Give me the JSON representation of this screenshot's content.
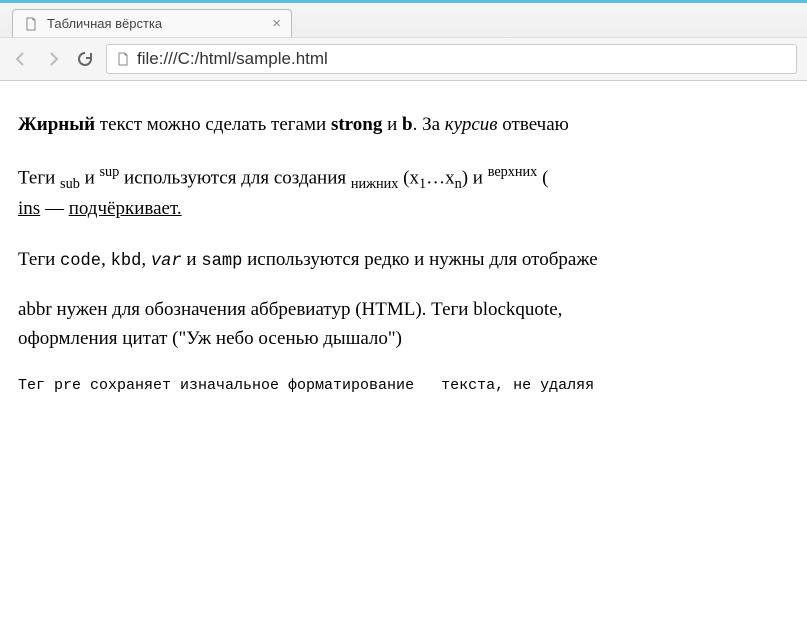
{
  "tab": {
    "title": "Табличная вёрстка"
  },
  "url": "file:///C:/html/sample.html",
  "para1": {
    "t1": "Жирный",
    "t2": " текст можно сделать тегами ",
    "t3": "strong",
    "t4": " и ",
    "t5": "b",
    "t6": ". За ",
    "t7": "курсив",
    "t8": " отвечаю"
  },
  "para2": {
    "t1": "Теги ",
    "t2": "sub",
    "t3": " и ",
    "t4": "sup",
    "t5": " используются для создания ",
    "t6": "нижних",
    "t7": " (x",
    "t8": "1",
    "t9": "…x",
    "t10": "n",
    "t11": ") и ",
    "t12": "верхних",
    "t13": " (",
    "t14": "ins",
    "t15": " — ",
    "t16": "подчёркивает."
  },
  "para3": {
    "t1": "Теги ",
    "t2": "code",
    "t3": ", ",
    "t4": "kbd",
    "t5": ", ",
    "t6": "var",
    "t7": " и ",
    "t8": "samp",
    "t9": " используются редко и нужны для отображе"
  },
  "para4": {
    "t1": "abbr нужен для обозначения аббревиатур (HTML). Теги blockquote, ",
    "t2": "оформления цитат (\"Уж небо осенью дышало\")"
  },
  "para5": {
    "t1": "Тег pre сохраняет изначальное форматирование   текста, не удаляя "
  }
}
